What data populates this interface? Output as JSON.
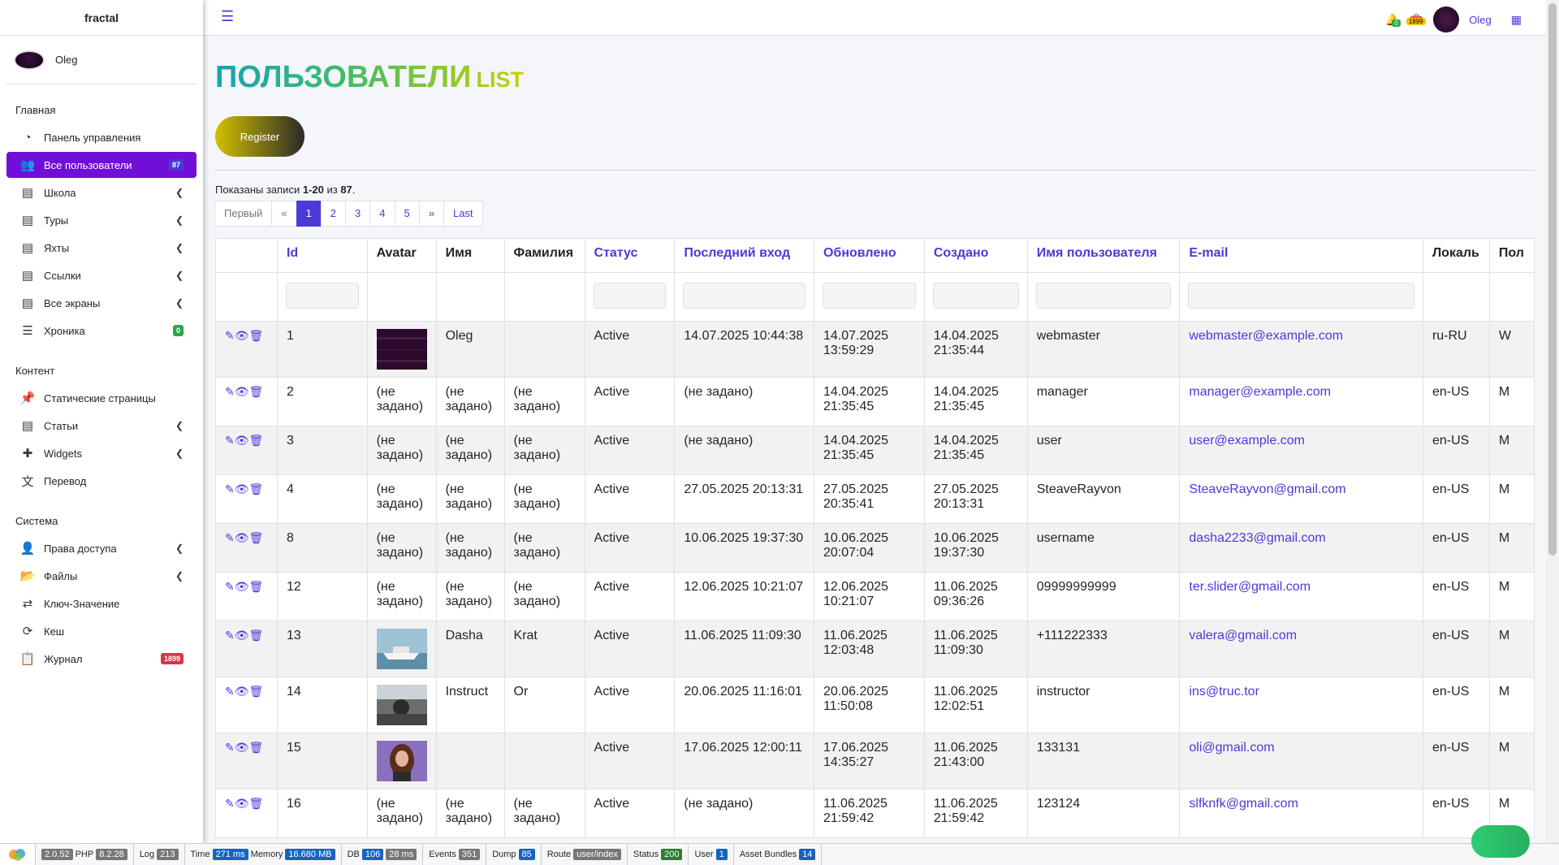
{
  "brand": "fractal",
  "user": {
    "name": "Oleg"
  },
  "nav": {
    "h1": "Главная",
    "dashboard": "Панель управления",
    "users": "Все пользователи",
    "users_badge": "87",
    "school": "Школа",
    "tours": "Туры",
    "yachts": "Яхты",
    "links": "Ссылки",
    "screens": "Все экраны",
    "chronicle": "Хроника",
    "chronicle_badge": "0",
    "h2": "Контент",
    "static": "Статические страницы",
    "articles": "Статьи",
    "widgets": "Widgets",
    "translate": "Перевод",
    "h3": "Система",
    "access": "Права доступа",
    "files": "Файлы",
    "kv": "Ключ-Значение",
    "cache": "Кеш",
    "journal": "Журнал",
    "journal_badge": "1899"
  },
  "header": {
    "bell_count": "0",
    "box_count": "1899",
    "user_name": "Oleg"
  },
  "page": {
    "title": "ПОЛЬЗОВАТЕЛИ",
    "title_small": "LIST",
    "register": "Register",
    "summary_pre": "Показаны записи ",
    "summary_range": "1-20",
    "summary_mid": " из ",
    "summary_total": "87",
    "summary_end": "."
  },
  "pager": {
    "first": "Первый",
    "prev": "«",
    "p1": "1",
    "p2": "2",
    "p3": "3",
    "p4": "4",
    "p5": "5",
    "next": "»",
    "last": "Last"
  },
  "columns": {
    "id": "Id",
    "avatar": "Avatar",
    "name": "Имя",
    "surname": "Фамилия",
    "status": "Статус",
    "last_login": "Последний вход",
    "updated": "Обновлено",
    "created": "Создано",
    "username": "Имя пользователя",
    "email": "E-mail",
    "locale": "Локаль",
    "gender": "Пол"
  },
  "rows": [
    {
      "id": "1",
      "name": "Oleg",
      "surname": "",
      "status": "Active",
      "last": "14.07.2025 10:44:38",
      "upd": "14.07.2025 13:59:29",
      "cr": "14.04.2025 21:35:44",
      "user": "webmaster",
      "email": "webmaster@example.com",
      "loc": "ru-RU",
      "g": "W",
      "avatar": "dark"
    },
    {
      "id": "2",
      "name": "(не задано)",
      "surname": "(не задано)",
      "avatar_text": "(не задано)",
      "status": "Active",
      "last": "(не задано)",
      "upd": "14.04.2025 21:35:45",
      "cr": "14.04.2025 21:35:45",
      "user": "manager",
      "email": "manager@example.com",
      "loc": "en-US",
      "g": "M"
    },
    {
      "id": "3",
      "name": "(не задано)",
      "surname": "(не задано)",
      "avatar_text": "(не задано)",
      "status": "Active",
      "last": "(не задано)",
      "upd": "14.04.2025 21:35:45",
      "cr": "14.04.2025 21:35:45",
      "user": "user",
      "email": "user@example.com",
      "loc": "en-US",
      "g": "M"
    },
    {
      "id": "4",
      "name": "(не задано)",
      "surname": "(не задано)",
      "avatar_text": "(не задано)",
      "status": "Active",
      "last": "27.05.2025 20:13:31",
      "upd": "27.05.2025 20:35:41",
      "cr": "27.05.2025 20:13:31",
      "user": "SteaveRayvon",
      "email": "SteaveRayvon@gmail.com",
      "loc": "en-US",
      "g": "M"
    },
    {
      "id": "8",
      "name": "(не задано)",
      "surname": "(не задано)",
      "avatar_text": "(не задано)",
      "status": "Active",
      "last": "10.06.2025 19:37:30",
      "upd": "10.06.2025 20:07:04",
      "cr": "10.06.2025 19:37:30",
      "user": "username",
      "email": "dasha2233@gmail.com",
      "loc": "en-US",
      "g": "M"
    },
    {
      "id": "12",
      "name": "(не задано)",
      "surname": "(не задано)",
      "avatar_text": "(не задано)",
      "status": "Active",
      "last": "12.06.2025 10:21:07",
      "upd": "12.06.2025 10:21:07",
      "cr": "11.06.2025 09:36:26",
      "user": "09999999999",
      "email": "ter.slider@gmail.com",
      "loc": "en-US",
      "g": "M"
    },
    {
      "id": "13",
      "name": "Dasha",
      "surname": "Krat",
      "status": "Active",
      "last": "11.06.2025 11:09:30",
      "upd": "11.06.2025 12:03:48",
      "cr": "11.06.2025 11:09:30",
      "user": "+111222333",
      "email": "valera@gmail.com",
      "loc": "en-US",
      "g": "M",
      "avatar": "yacht"
    },
    {
      "id": "14",
      "name": "Instruct",
      "surname": "Or",
      "status": "Active",
      "last": "20.06.2025 11:16:01",
      "upd": "20.06.2025 11:50:08",
      "cr": "11.06.2025 12:02:51",
      "user": "instructor",
      "email": "ins@truc.tor",
      "loc": "en-US",
      "g": "M",
      "avatar": "boat"
    },
    {
      "id": "15",
      "name": "",
      "surname": "",
      "status": "Active",
      "last": "17.06.2025 12:00:11",
      "upd": "17.06.2025 14:35:27",
      "cr": "11.06.2025 21:43:00",
      "user": "133131",
      "email": "oli@gmail.com",
      "loc": "en-US",
      "g": "M",
      "avatar": "girl"
    },
    {
      "id": "16",
      "name": "(не задано)",
      "surname": "(не задано)",
      "avatar_text": "(не задано)",
      "status": "Active",
      "last": "(не задано)",
      "upd": "11.06.2025 21:59:42",
      "cr": "11.06.2025 21:59:42",
      "user": "123124",
      "email": "slfknfk@gmail.com",
      "loc": "en-US",
      "g": "M"
    }
  ],
  "debug": {
    "version": "2.0.52",
    "php_l": "PHP",
    "php": "8.2.28",
    "log_l": "Log",
    "log": "213",
    "time_l": "Time",
    "time": "271 ms",
    "mem_l": "Memory",
    "mem": "16.680 MB",
    "db_l": "DB",
    "db": "106",
    "db_ms": "28 ms",
    "ev_l": "Events",
    "ev": "351",
    "dump_l": "Dump",
    "dump": "85",
    "route_l": "Route",
    "route": "user/index",
    "status_l": "Status",
    "status": "200",
    "user_l": "User",
    "user": "1",
    "ab_l": "Asset Bundles",
    "ab": "14"
  }
}
